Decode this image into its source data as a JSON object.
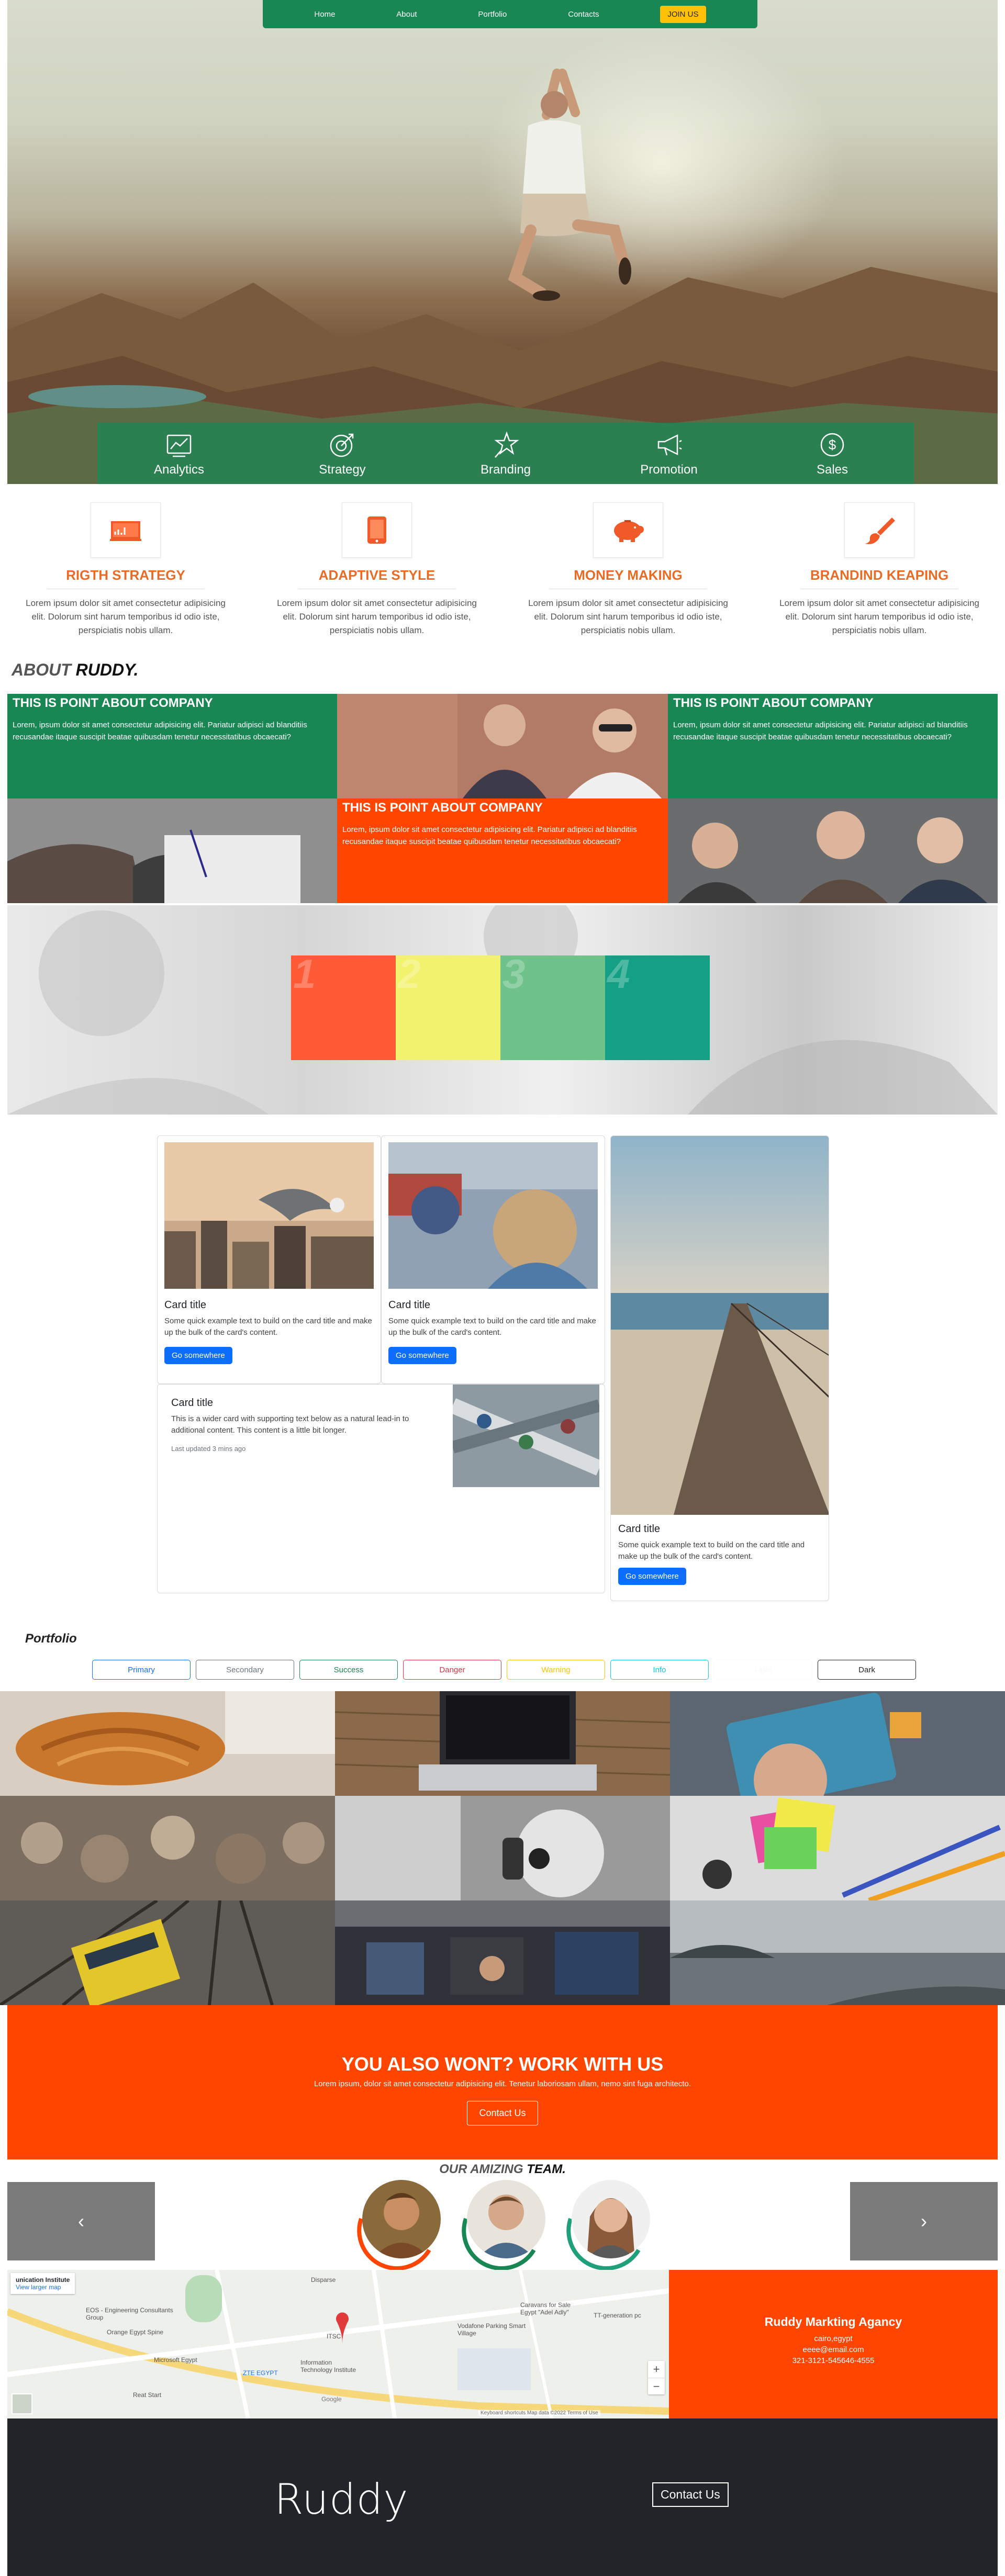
{
  "nav": {
    "items": [
      "Home",
      "About",
      "Portfolio",
      "Contacts"
    ],
    "join_label": "JOIN US"
  },
  "features": [
    {
      "label": "Analytics",
      "icon": "analytics-chart-icon"
    },
    {
      "label": "Strategy",
      "icon": "target-arrow-icon"
    },
    {
      "label": "Branding",
      "icon": "pin-star-icon"
    },
    {
      "label": "Promotion",
      "icon": "megaphone-icon"
    },
    {
      "label": "Sales",
      "icon": "dollar-coin-icon"
    }
  ],
  "services": [
    {
      "title": "RIGTH STRATEGY",
      "text": "Lorem ipsum dolor sit amet consectetur adipisicing elit. Dolorum sint harum temporibus id odio iste, perspiciatis nobis ullam.",
      "icon": "presentation-board-icon"
    },
    {
      "title": "ADAPTIVE STYLE",
      "text": "Lorem ipsum dolor sit amet consectetur adipisicing elit. Dolorum sint harum temporibus id odio iste, perspiciatis nobis ullam.",
      "icon": "tablet-icon"
    },
    {
      "title": "MONEY MAKING",
      "text": "Lorem ipsum dolor sit amet consectetur adipisicing elit. Dolorum sint harum temporibus id odio iste, perspiciatis nobis ullam.",
      "icon": "piggy-bank-icon"
    },
    {
      "title": "BRANDIND KEAPING",
      "text": "Lorem ipsum dolor sit amet consectetur adipisicing elit. Dolorum sint harum temporibus id odio iste, perspiciatis nobis ullam.",
      "icon": "paint-brush-icon"
    }
  ],
  "about": {
    "heading_light": "ABOUT",
    "heading_bold": "RUDDY.",
    "tiles": [
      {
        "title": "THIS IS POINT ABOUT COMPANY",
        "text": "Lorem, ipsum dolor sit amet consectetur adipisicing elit. Pariatur adipisci ad blanditiis recusandae itaque suscipit beatae quibusdam tenetur necessitatibus obcaecati?"
      },
      {
        "title": "THIS IS POINT ABOUT COMPANY",
        "text": "Lorem, ipsum dolor sit amet consectetur adipisicing elit. Pariatur adipisci ad blanditiis recusandae itaque suscipit beatae quibusdam tenetur necessitatibus obcaecati?"
      },
      {
        "title": "THIS IS POINT ABOUT COMPANY",
        "text": "Lorem, ipsum dolor sit amet consectetur adipisicing elit. Pariatur adipisci ad blanditiis recusandae itaque suscipit beatae quibusdam tenetur necessitatibus obcaecati?"
      }
    ]
  },
  "numbers": [
    {
      "label": "1",
      "color": "#ff5a36"
    },
    {
      "label": "2",
      "color": "#f2f26e"
    },
    {
      "label": "3",
      "color": "#6ec28a"
    },
    {
      "label": "4",
      "color": "#14a085"
    }
  ],
  "cards": {
    "card1": {
      "title": "Card title",
      "text": "Some quick example text to build on the card title and make up the bulk of the card's content.",
      "button": "Go somewhere"
    },
    "card2": {
      "title": "Card title",
      "text": "Some quick example text to build on the card title and make up the bulk of the card's content.",
      "button": "Go somewhere"
    },
    "card3": {
      "title": "Card title",
      "text": "Some quick example text to build on the card title and make up the bulk of the card's content.",
      "button": "Go somewhere"
    },
    "card_wide": {
      "title": "Card title",
      "text": "This is a wider card with supporting text below as a natural lead-in to additional content. This content is a little bit longer.",
      "updated": "Last updated 3 mins ago"
    }
  },
  "portfolio": {
    "title": "Portfolio",
    "filters": [
      {
        "label": "Primary",
        "color": "#0d6efd"
      },
      {
        "label": "Secondary",
        "color": "#6c757d"
      },
      {
        "label": "Success",
        "color": "#198754"
      },
      {
        "label": "Danger",
        "color": "#dc3545"
      },
      {
        "label": "Warning",
        "color": "#ffc107"
      },
      {
        "label": "Info",
        "color": "#0dcaf0"
      },
      {
        "label": "Light",
        "color": "#f8f9fa"
      },
      {
        "label": "Dark",
        "color": "#212529"
      }
    ]
  },
  "cta": {
    "title": "YOU ALSO WONT? WORK WITH US",
    "text": "Lorem ipsum, dolor sit amet consectetur adipisicing elit. Tenetur laboriosam ullam, nemo sint fuga architecto.",
    "button": "Contact Us"
  },
  "team": {
    "heading_light": "OUR AMIZING",
    "heading_bold": "TEAM.",
    "prev": "‹",
    "next": "›"
  },
  "map": {
    "title": "unication Institute",
    "subtitle": "View larger map",
    "places": [
      "Disparse",
      "ITSC",
      "EOS - Engineering Consultants Group",
      "Orange Egypt Spine",
      "Microsoft Egypt",
      "ZTE EGYPT",
      "Vodafone Parking Smart Village",
      "Information Technology Institute",
      "Caravans for Sale Egypt \"Adel Adly\"",
      "Reat Start",
      "TT-generation pc",
      "Google"
    ],
    "footer": "Keyboard shortcuts   Map data ©2022   Terms of Use",
    "zoom_in": "+",
    "zoom_out": "−"
  },
  "agency": {
    "name": "Ruddy Markting Agancy",
    "city": "cairo,egypt",
    "email": "eeee@email.com",
    "phone": "321-3121-545646-4555"
  },
  "footer": {
    "brand": "Ruddy",
    "contact_button": "Contact Us"
  }
}
